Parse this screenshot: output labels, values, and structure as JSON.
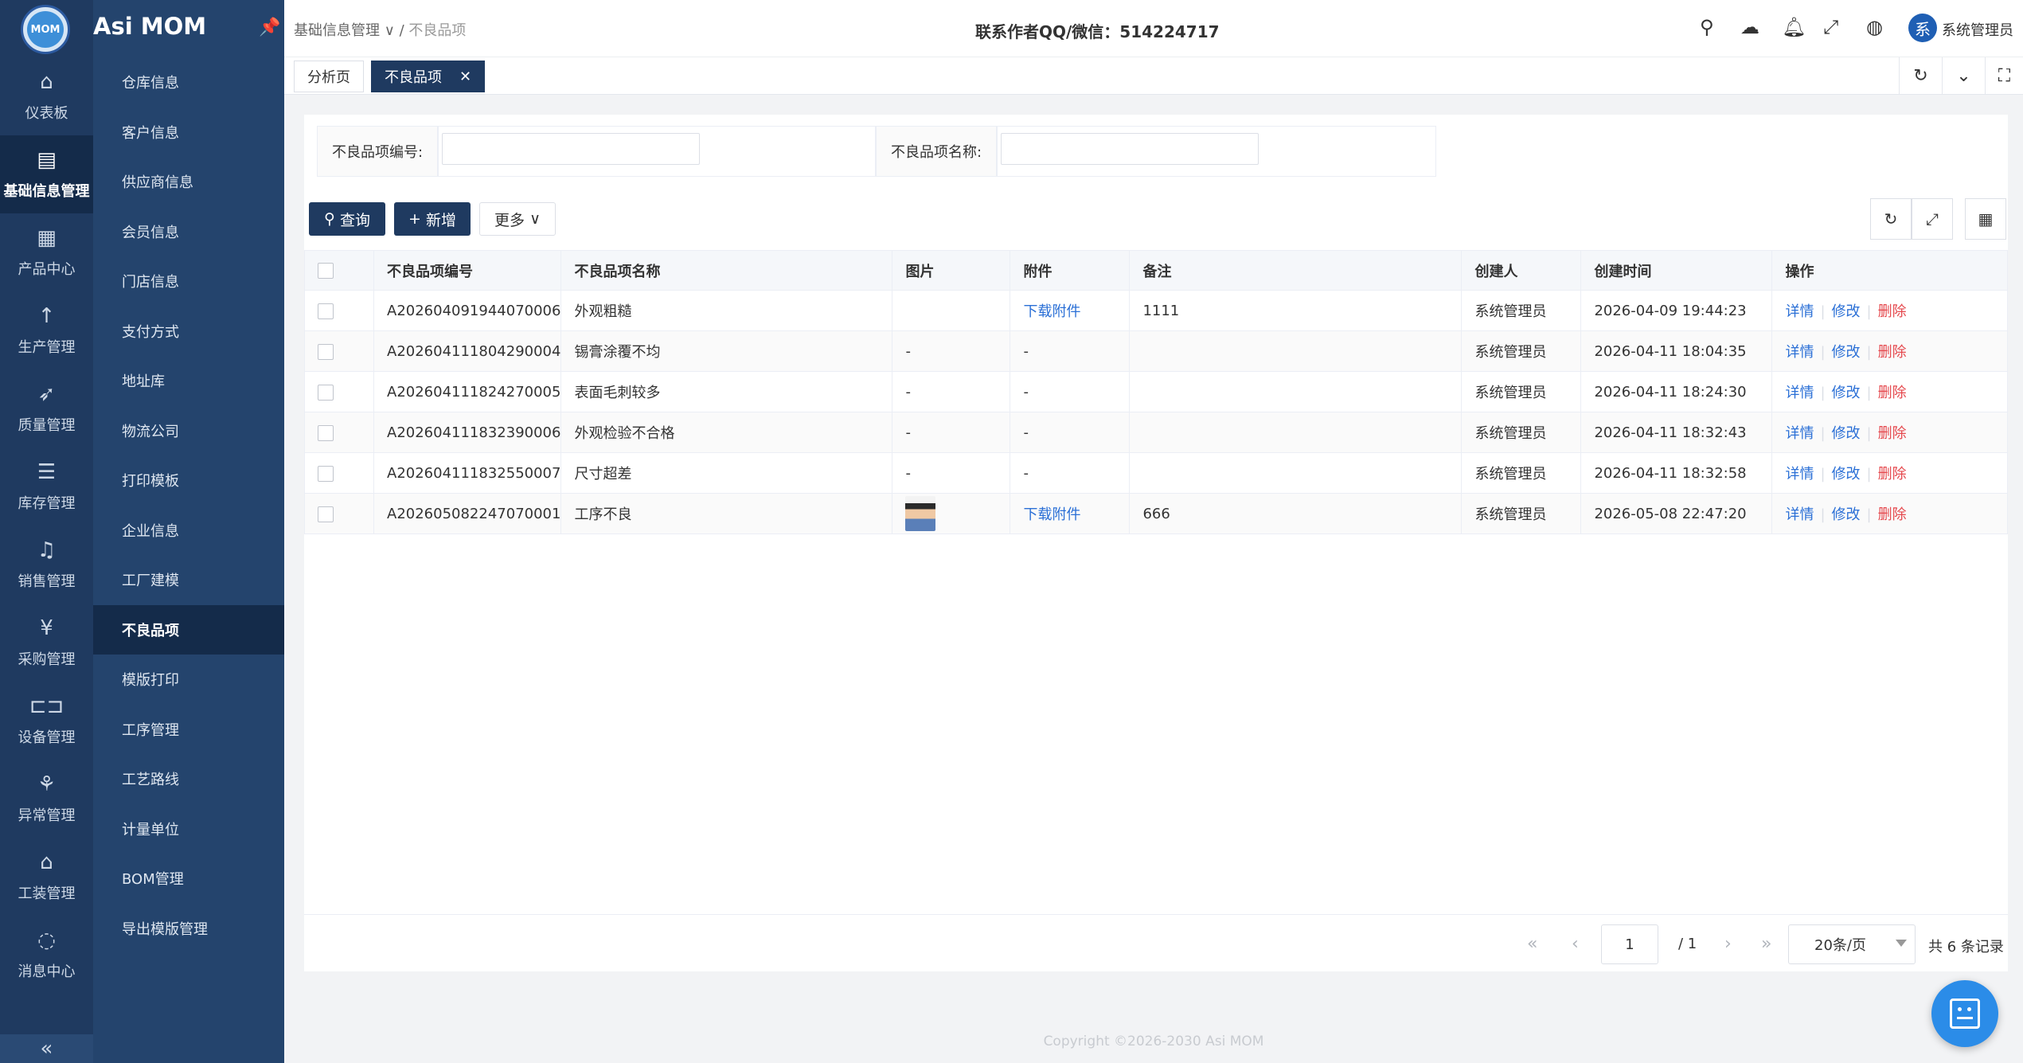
{
  "app": {
    "logo_text": "MOM",
    "title": "Asi MOM"
  },
  "rail": [
    {
      "icon": "home-icon",
      "glyph": "⌂",
      "label": "仪表板"
    },
    {
      "icon": "document-icon",
      "glyph": "▤",
      "label": "基础信息管理",
      "active": true
    },
    {
      "icon": "grid-icon",
      "glyph": "▦",
      "label": "产品中心"
    },
    {
      "icon": "arrow-up-icon",
      "glyph": "↑",
      "label": "生产管理"
    },
    {
      "icon": "rocket-icon",
      "glyph": "➶",
      "label": "质量管理"
    },
    {
      "icon": "list-icon",
      "glyph": "☰",
      "label": "库存管理"
    },
    {
      "icon": "bell-icon",
      "glyph": "♫",
      "label": "销售管理"
    },
    {
      "icon": "yen-icon",
      "glyph": "¥",
      "label": "采购管理"
    },
    {
      "icon": "device-icon",
      "glyph": "⊏⊐",
      "label": "设备管理"
    },
    {
      "icon": "tree-icon",
      "glyph": "⚘",
      "label": "异常管理"
    },
    {
      "icon": "bank-icon",
      "glyph": "⌂",
      "label": "工装管理"
    },
    {
      "icon": "chat-icon",
      "glyph": "◌",
      "label": "消息中心"
    }
  ],
  "submenu": [
    {
      "label": "仓库信息"
    },
    {
      "label": "客户信息"
    },
    {
      "label": "供应商信息"
    },
    {
      "label": "会员信息"
    },
    {
      "label": "门店信息"
    },
    {
      "label": "支付方式"
    },
    {
      "label": "地址库"
    },
    {
      "label": "物流公司"
    },
    {
      "label": "打印模板"
    },
    {
      "label": "企业信息"
    },
    {
      "label": "工厂建模"
    },
    {
      "label": "不良品项",
      "active": true
    },
    {
      "label": "模版打印"
    },
    {
      "label": "工序管理"
    },
    {
      "label": "工艺路线"
    },
    {
      "label": "计量单位"
    },
    {
      "label": "BOM管理"
    },
    {
      "label": "导出模版管理"
    }
  ],
  "header": {
    "breadcrumb_parent": "基础信息管理",
    "breadcrumb_sep": " / ",
    "breadcrumb_current": "不良品项",
    "contact": "联系作者QQ/微信：514224717",
    "user_avatar": "系",
    "user_name": "系统管理员"
  },
  "tabs": [
    {
      "label": "分析页"
    },
    {
      "label": "不良品项",
      "active": true
    }
  ],
  "search": {
    "code_label": "不良品项编号:",
    "code_value": "",
    "name_label": "不良品项名称:",
    "name_value": ""
  },
  "toolbar": {
    "query": "查询",
    "add": "新增",
    "more": "更多"
  },
  "table": {
    "columns": [
      "不良品项编号",
      "不良品项名称",
      "图片",
      "附件",
      "备注",
      "创建人",
      "创建时间",
      "操作"
    ],
    "actions": {
      "detail": "详情",
      "edit": "修改",
      "delete": "删除"
    },
    "rows": [
      {
        "code": "A202604091944070006",
        "name": "外观粗糙",
        "image": "",
        "attachment": "下载附件",
        "remark": "1111",
        "creator": "系统管理员",
        "time": "2026-04-09 19:44:23"
      },
      {
        "code": "A202604111804290004",
        "name": "锡膏涂覆不均",
        "image": "-",
        "attachment": "-",
        "remark": "",
        "creator": "系统管理员",
        "time": "2026-04-11 18:04:35"
      },
      {
        "code": "A202604111824270005",
        "name": "表面毛刺较多",
        "image": "-",
        "attachment": "-",
        "remark": "",
        "creator": "系统管理员",
        "time": "2026-04-11 18:24:30"
      },
      {
        "code": "A202604111832390006",
        "name": "外观检验不合格",
        "image": "-",
        "attachment": "-",
        "remark": "",
        "creator": "系统管理员",
        "time": "2026-04-11 18:32:43"
      },
      {
        "code": "A202604111832550007",
        "name": "尺寸超差",
        "image": "-",
        "attachment": "-",
        "remark": "",
        "creator": "系统管理员",
        "time": "2026-04-11 18:32:58"
      },
      {
        "code": "A202605082247070001",
        "name": "工序不良",
        "image": "photo",
        "attachment": "下载附件",
        "remark": "666",
        "creator": "系统管理员",
        "time": "2026-05-08 22:47:20"
      }
    ]
  },
  "pagination": {
    "page": "1",
    "total_pages": "/ 1",
    "page_size": "20条/页",
    "record_count": "共 6 条记录"
  },
  "footer": "Copyright ©2026-2030 Asi MOM"
}
